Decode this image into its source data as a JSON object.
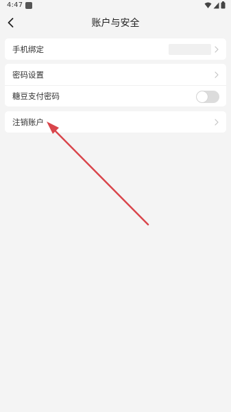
{
  "status_bar": {
    "time": "4:47",
    "icons": [
      "wifi-icon",
      "signal-icon",
      "battery-icon"
    ]
  },
  "header": {
    "title": "账户与安全",
    "back_icon": "chevron-left-icon"
  },
  "groups": [
    {
      "items": [
        {
          "label": "手机绑定",
          "value": "",
          "control": "chevron"
        }
      ]
    },
    {
      "items": [
        {
          "label": "密码设置",
          "control": "chevron"
        },
        {
          "label": "糖豆支付密码",
          "control": "toggle",
          "toggle_on": false
        }
      ]
    },
    {
      "items": [
        {
          "label": "注销账户",
          "control": "chevron"
        }
      ]
    }
  ],
  "colors": {
    "background": "#f4f4f4",
    "card": "#ffffff",
    "annotation_arrow": "#d9454b",
    "toggle_off": "#dcdcdc"
  }
}
